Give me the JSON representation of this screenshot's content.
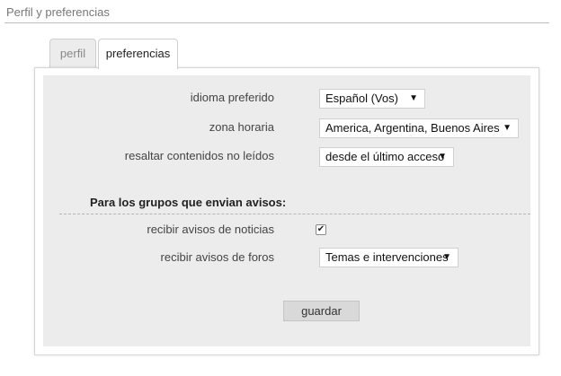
{
  "header": {
    "title": "Perfil y preferencias"
  },
  "tabs": [
    {
      "label": "perfil",
      "active": false
    },
    {
      "label": "preferencias",
      "active": true
    }
  ],
  "form": {
    "language": {
      "label": "idioma preferido",
      "value": "Español (Vos)"
    },
    "timezone": {
      "label": "zona horaria",
      "value": "America, Argentina, Buenos Aires"
    },
    "highlight": {
      "label": "resaltar contenidos no leídos",
      "value": "desde el último acceso"
    },
    "groups_title": "Para los grupos que envian avisos:",
    "news_notices": {
      "label": "recibir avisos de noticias",
      "checked": true
    },
    "forum_notices": {
      "label": "recibir avisos de foros",
      "value": "Temas e intervenciones"
    },
    "save_label": "guardar"
  },
  "icons": {
    "dropdown": "caret-down-icon",
    "check": "checkmark-icon"
  }
}
